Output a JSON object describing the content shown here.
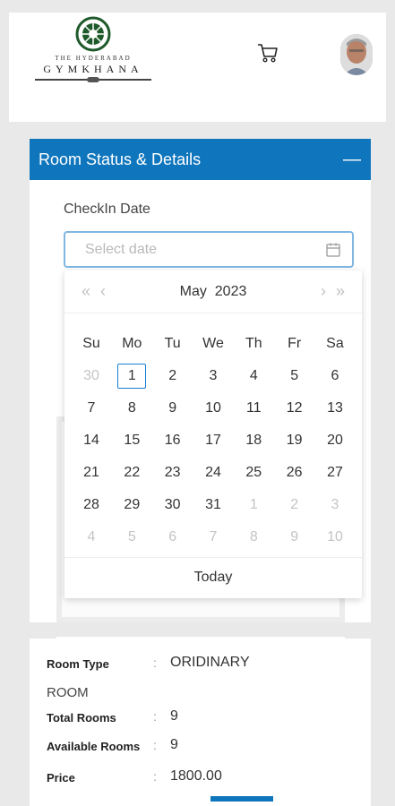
{
  "header": {
    "logo_top": "THE HYDERABAD",
    "logo_main": "GYMKHANA",
    "cart_icon": "cart-icon",
    "avatar_icon": "user-avatar"
  },
  "panel": {
    "title": "Room Status & Details",
    "collapse_label": "—",
    "checkin_label": "CheckIn Date",
    "date_placeholder": "Select date",
    "accent": "#0f76bd"
  },
  "calendar": {
    "month": "May",
    "year": "2023",
    "prev_year": "«",
    "prev_month": "‹",
    "next_month": "›",
    "next_year": "»",
    "weekdays": [
      "Su",
      "Mo",
      "Tu",
      "We",
      "Th",
      "Fr",
      "Sa"
    ],
    "weeks": [
      [
        "30",
        "1",
        "2",
        "3",
        "4",
        "5",
        "6"
      ],
      [
        "7",
        "8",
        "9",
        "10",
        "11",
        "12",
        "13"
      ],
      [
        "14",
        "15",
        "16",
        "17",
        "18",
        "19",
        "20"
      ],
      [
        "21",
        "22",
        "23",
        "24",
        "25",
        "26",
        "27"
      ],
      [
        "28",
        "29",
        "30",
        "31",
        "1",
        "2",
        "3"
      ],
      [
        "4",
        "5",
        "6",
        "7",
        "8",
        "9",
        "10"
      ]
    ],
    "today_label": "Today"
  },
  "details": {
    "room_type_label": "Room Type",
    "room_type_value": "ORIDINARY",
    "room_type_cont": "ROOM",
    "total_rooms_label": "Total Rooms",
    "total_rooms_value": "9",
    "available_rooms_label": "Available Rooms",
    "available_rooms_value": "9",
    "price_label": "Price",
    "price_value": "1800.00",
    "colon": ":"
  }
}
